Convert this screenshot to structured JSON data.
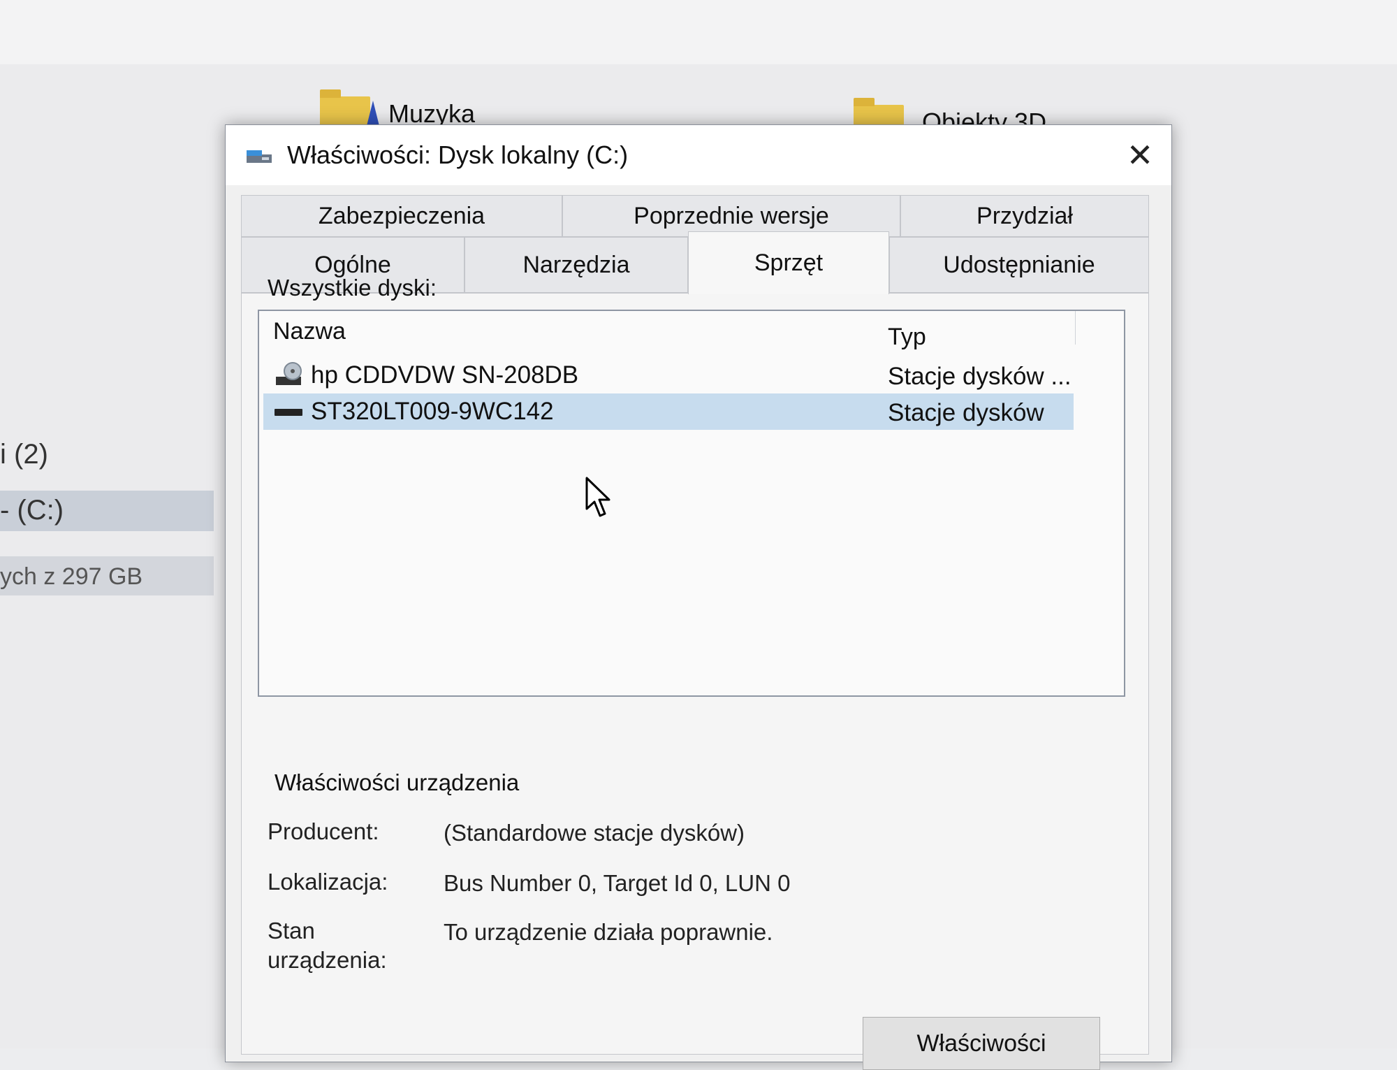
{
  "background": {
    "folders": [
      {
        "label": "Muzyka",
        "icon": "music-folder-icon"
      },
      {
        "label": "Obiekty 3D",
        "icon": "folder-icon"
      }
    ],
    "sidebar": {
      "item_count": "i (2)",
      "selected_drive": "- (C:)",
      "storage_text": "ych z 297 GB"
    }
  },
  "dialog": {
    "title": "Właściwości: Dysk lokalny (C:)",
    "close_label": "✕",
    "tabs_row1": [
      "Zabezpieczenia",
      "Poprzednie wersje",
      "Przydział"
    ],
    "tabs_row2": [
      "Ogólne",
      "Narzędzia",
      "Sprzęt",
      "Udostępnianie"
    ],
    "active_tab": "Sprzęt",
    "all_disks_label": "Wszystkie dyski:",
    "columns": {
      "name": "Nazwa",
      "type": "Typ"
    },
    "devices": [
      {
        "name": "hp CDDVDW SN-208DB",
        "type": "Stacje dysków ...",
        "icon": "cd-drive-icon",
        "selected": false
      },
      {
        "name": "ST320LT009-9WC142",
        "type": "Stacje dysków",
        "icon": "hard-disk-icon",
        "selected": true
      }
    ],
    "device_properties": {
      "heading": "Właściwości urządzenia",
      "manufacturer_label": "Producent:",
      "manufacturer_value": "(Standardowe stacje dysków)",
      "location_label": "Lokalizacja:",
      "location_value": "Bus Number 0, Target Id 0, LUN 0",
      "status_label_line1": "Stan",
      "status_label_line2": "urządzenia:",
      "status_value": "To urządzenie działa poprawnie."
    },
    "properties_button": "Właściwości"
  },
  "colors": {
    "selection": "#c7dcee",
    "dialog_bg": "#f0f0f0",
    "folder": "#e8c44a"
  }
}
